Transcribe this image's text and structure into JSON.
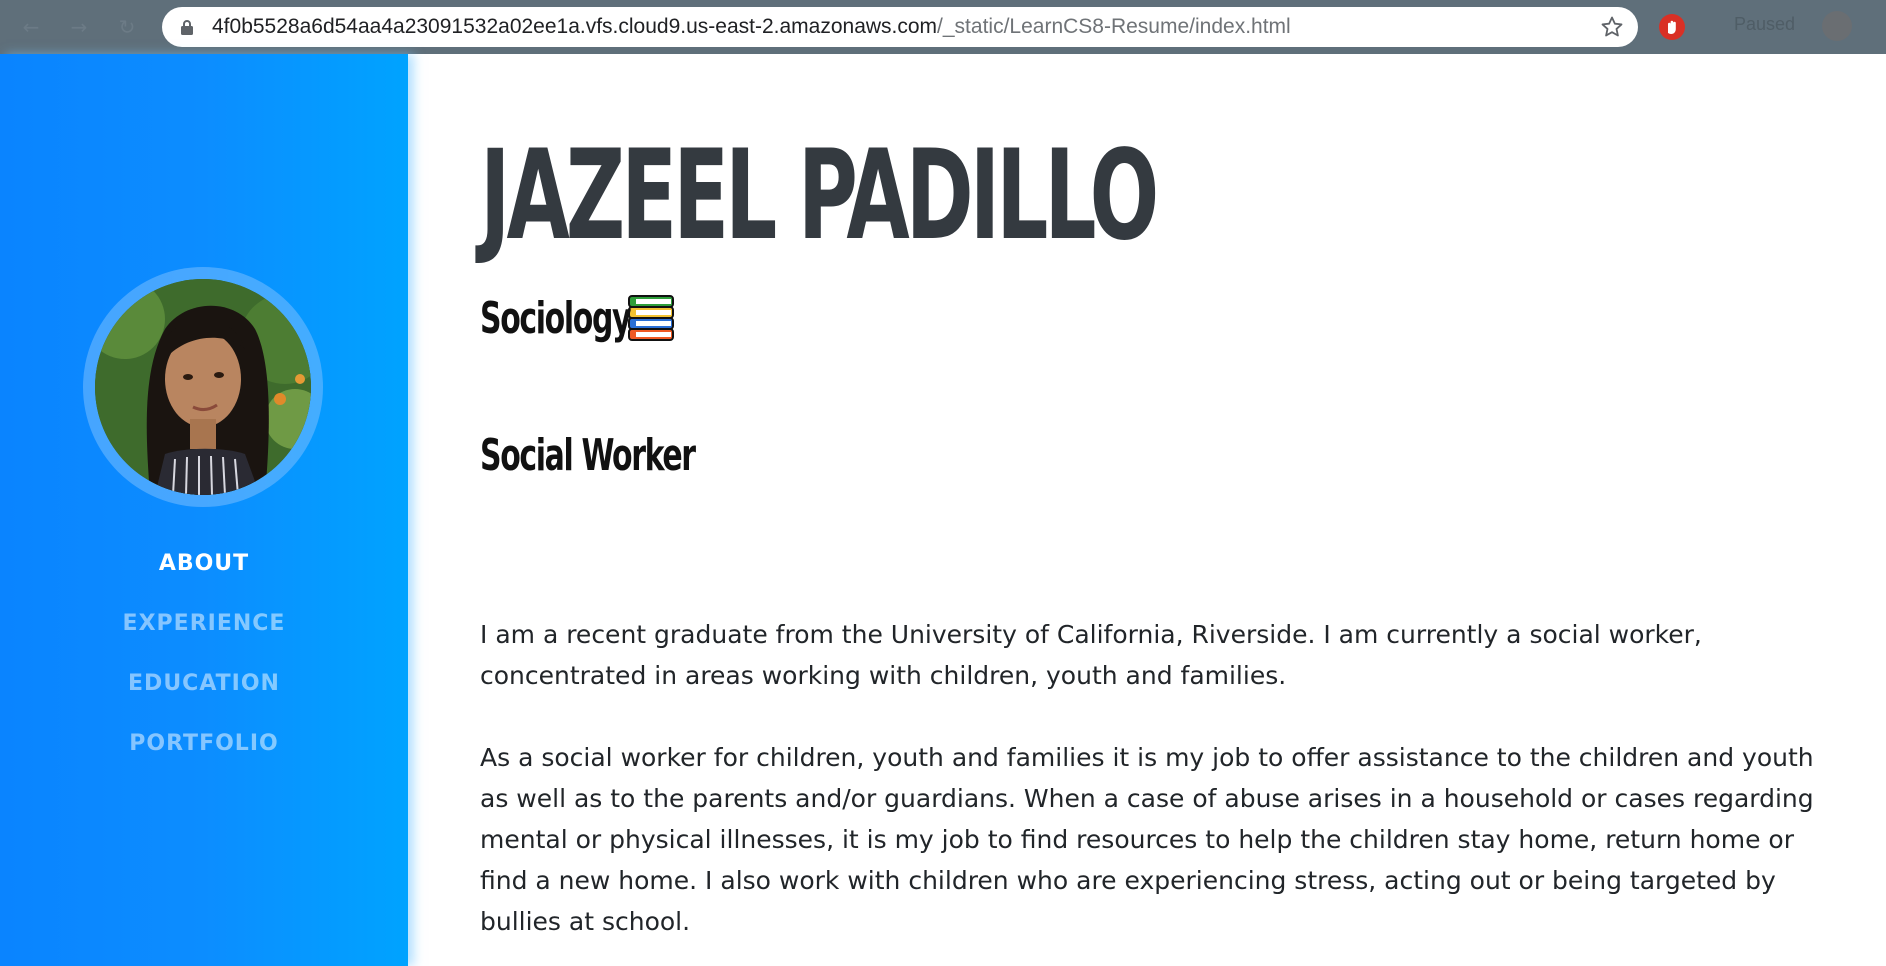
{
  "browser": {
    "url_host": "4f0b5528a6d54aa4a23091532a02ee1a.vfs.cloud9.us-east-2.amazonaws.com",
    "url_path": "/_static/LearnCS8-Resume/index.html",
    "profile_name": "Paused",
    "icons": [
      "back-icon",
      "forward-icon",
      "reload-icon",
      "lock-icon",
      "star-icon",
      "extension-icon",
      "profile-avatar"
    ]
  },
  "sidebar": {
    "avatar_alt": "profile photo",
    "nav": [
      {
        "label": "ABOUT",
        "active": true
      },
      {
        "label": "EXPERIENCE",
        "active": false
      },
      {
        "label": "EDUCATION",
        "active": false
      },
      {
        "label": "PORTFOLIO",
        "active": false
      }
    ]
  },
  "main": {
    "name": "JAZEEL PADILLO",
    "subheading": "Sociology",
    "subheading_icon": "books-icon",
    "job_title": "Social Worker",
    "paragraphs": [
      "I am a recent graduate from the University of California, Riverside. I am currently a social worker, concentrated in areas working with children, youth and families.",
      "As a social worker for children, youth and families it is my job to offer assistance to the children and youth as well as to the parents and/or guardians. When a case of abuse arises in a household or cases regarding mental or physical illnesses, it is my job to find resources to help the children stay home, return home or find a new home. I also work with children who are experiencing stress, acting out or being targeted by bullies at school."
    ]
  },
  "colors": {
    "sidebar_start": "#0a84ff",
    "sidebar_end": "#00a3ff",
    "heading": "#343a40",
    "text": "#212529"
  }
}
